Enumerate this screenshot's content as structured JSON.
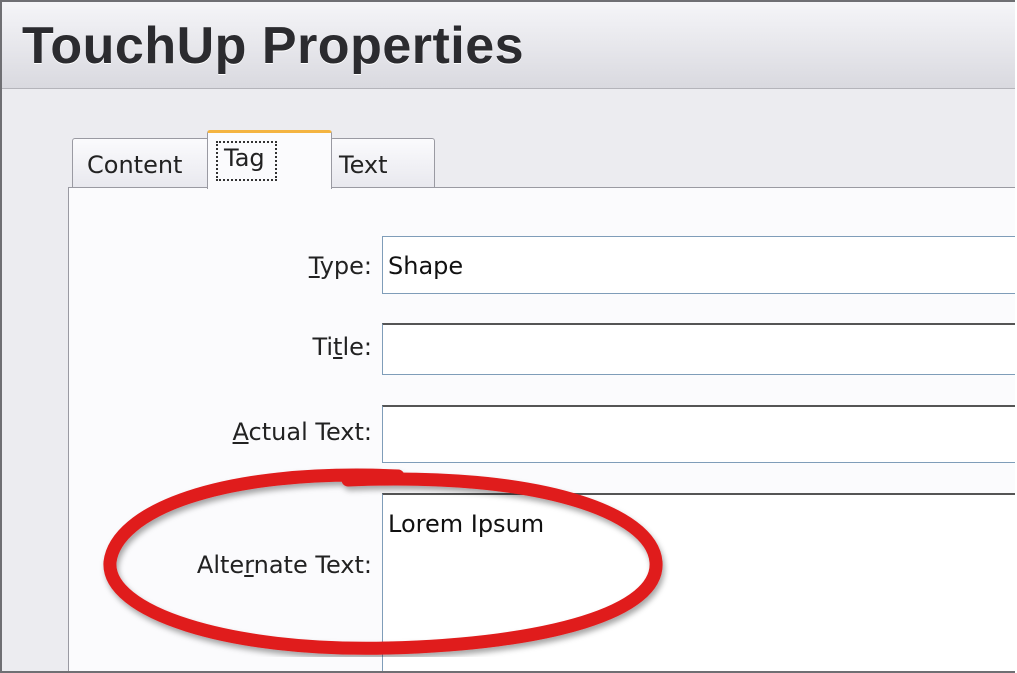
{
  "window": {
    "title": "TouchUp Properties"
  },
  "tabs": [
    {
      "label": "Content",
      "active": false
    },
    {
      "label": "Tag",
      "active": true
    },
    {
      "label": "Text",
      "active": false
    }
  ],
  "form": {
    "type": {
      "label_pre": "",
      "label_ul": "T",
      "label_post": "ype:",
      "value": "Shape"
    },
    "title": {
      "label_pre": "Ti",
      "label_ul": "t",
      "label_post": "le:",
      "value": ""
    },
    "actual_text": {
      "label_pre": "",
      "label_ul": "A",
      "label_post": "ctual Text:",
      "value": ""
    },
    "alternate_text": {
      "label_pre": "Alte",
      "label_ul": "r",
      "label_post": "nate Text:",
      "value": "Lorem Ipsum"
    }
  },
  "colors": {
    "highlight": "#e01b1b",
    "active_tab_accent": "#f4b441"
  }
}
